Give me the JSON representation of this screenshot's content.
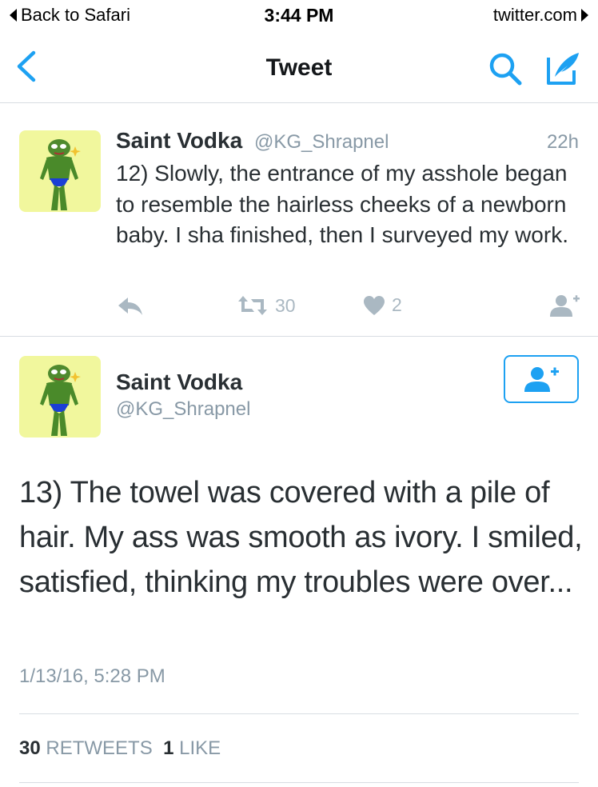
{
  "status_bar": {
    "back_label": "Back to Safari",
    "time": "3:44 PM",
    "site": "twitter.com"
  },
  "nav": {
    "title": "Tweet",
    "accent": "#1da1f2"
  },
  "tweet_reply": {
    "name": "Saint Vodka",
    "handle": "@KG_Shrapnel",
    "age": "22h",
    "text": "12) Slowly, the entrance of my asshole began to resemble the hairless cheeks of a newborn baby. I sha finished, then I surveyed my work.",
    "retweets": "30",
    "likes": "2"
  },
  "tweet_main": {
    "name": "Saint Vodka",
    "handle": "@KG_Shrapnel",
    "text": "13) The towel was covered with a pile of hair. My ass was smooth as ivory. I smiled, satisfied, thinking my troubles were over...",
    "date": "1/13/16, 5:28 PM",
    "retweet_count": "30",
    "retweet_label": "RETWEETS",
    "like_count": "1",
    "like_label": "LIKE"
  },
  "icons": {
    "back": "chevron-left-icon",
    "search": "search-icon",
    "compose": "compose-icon",
    "reply": "reply-icon",
    "retweet": "retweet-icon",
    "like": "heart-icon",
    "follow": "add-user-icon"
  }
}
